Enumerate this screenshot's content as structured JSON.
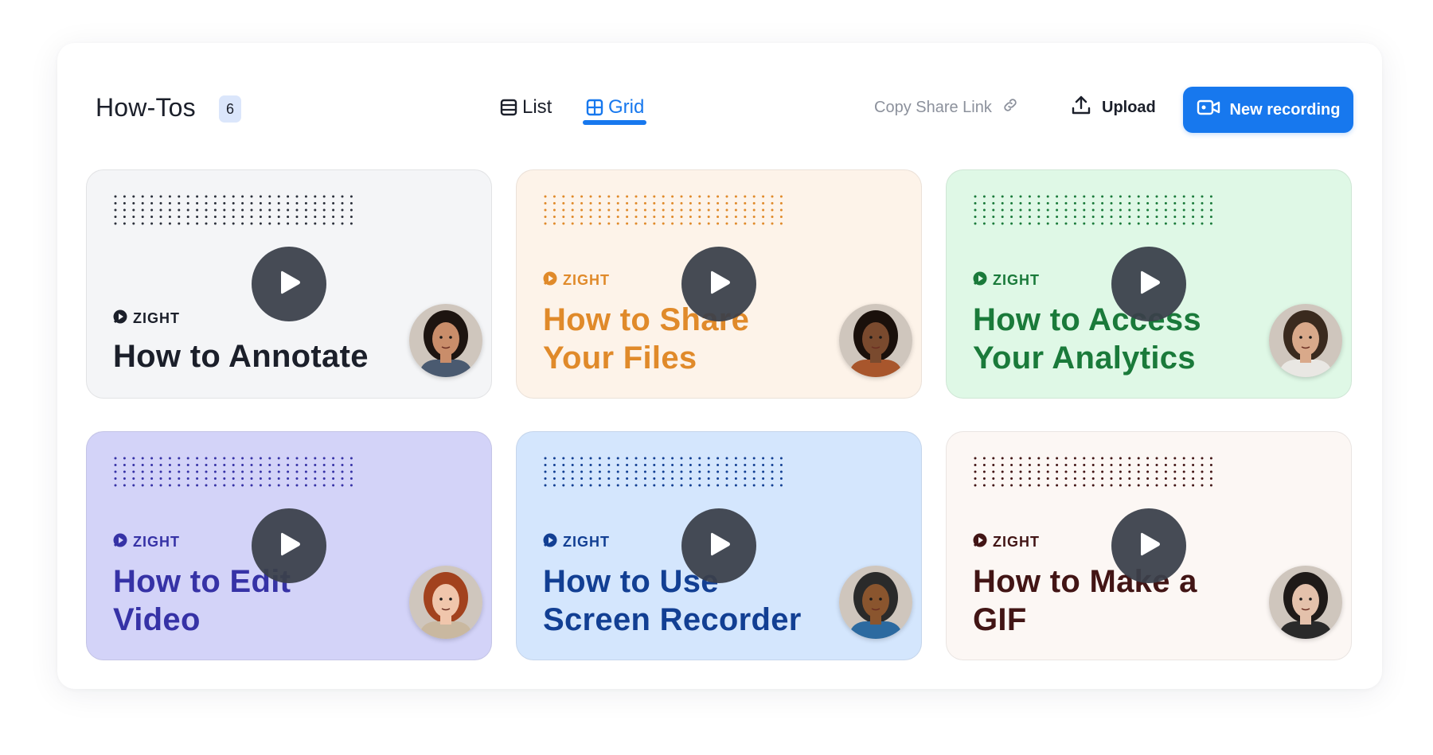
{
  "header": {
    "title": "How-Tos",
    "count": "6",
    "view_list_label": "List",
    "view_grid_label": "Grid",
    "active_view": "grid",
    "copy_share_link_label": "Copy Share Link",
    "upload_label": "Upload",
    "new_recording_label": "New recording"
  },
  "colors": {
    "accent": "#1778ee",
    "badge_bg": "#dbe6fb",
    "muted_text": "#8c919c"
  },
  "videos": [
    {
      "brand": "ZIGHT",
      "title_line1": "How to Annotate",
      "title_line2": "",
      "bg": "#f4f5f7",
      "text_color": "#1b1f2a",
      "dot_color": "#2a2f3a",
      "avatar": "woman-dark-hair",
      "skin": "#c98d6a",
      "hair": "#1d1410",
      "shirt": "#4a5a70"
    },
    {
      "brand": "ZIGHT",
      "title_line1": "How to Share",
      "title_line2": "Your Files",
      "bg": "#fdf3e9",
      "text_color": "#e08a2a",
      "dot_color": "#e08a2a",
      "avatar": "woman-curly-hair",
      "skin": "#7a4a2e",
      "hair": "#1a100b",
      "shirt": "#a8562c"
    },
    {
      "brand": "ZIGHT",
      "title_line1": "How to Access",
      "title_line2": "Your Analytics",
      "bg": "#dff8e6",
      "text_color": "#1a7a3a",
      "dot_color": "#1a7a3a",
      "avatar": "man-beard-cap",
      "skin": "#d9a98a",
      "hair": "#3a2a1e",
      "shirt": "#e9e7e3"
    },
    {
      "brand": "ZIGHT",
      "title_line1": "How to Edit",
      "title_line2": "Video",
      "bg": "#d3d3f8",
      "text_color": "#3632a6",
      "dot_color": "#3632a6",
      "avatar": "woman-red-hair",
      "skin": "#f0c6ac",
      "hair": "#a2421e",
      "shirt": "#c9b8a0"
    },
    {
      "brand": "ZIGHT",
      "title_line1": "How to Use",
      "title_line2": "Screen Recorder",
      "bg": "#d4e6fd",
      "text_color": "#123f93",
      "dot_color": "#123f93",
      "avatar": "man-hat-glasses",
      "skin": "#8a552e",
      "hair": "#2a2a2a",
      "shirt": "#2c6aa0"
    },
    {
      "brand": "ZIGHT",
      "title_line1": "How to Make a",
      "title_line2": "GIF",
      "bg": "#fcf7f4",
      "text_color": "#421515",
      "dot_color": "#421515",
      "avatar": "person-wavy-hair",
      "skin": "#e4c1ab",
      "hair": "#1f1a18",
      "shirt": "#2a2a2a"
    }
  ]
}
